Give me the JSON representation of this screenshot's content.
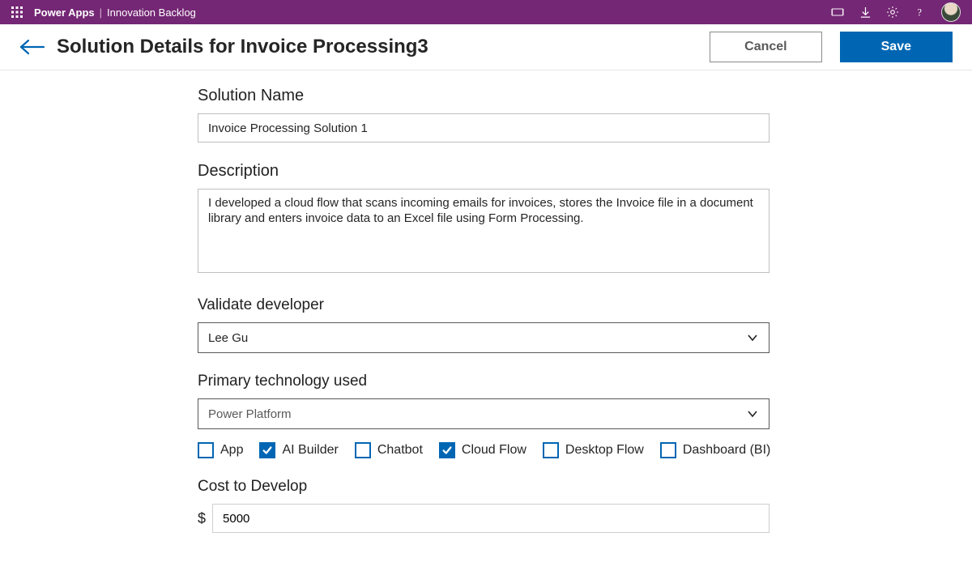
{
  "topbar": {
    "brand": "Power Apps",
    "app_name": "Innovation Backlog"
  },
  "header": {
    "title": "Solution Details for Invoice Processing3",
    "cancel_label": "Cancel",
    "save_label": "Save"
  },
  "form": {
    "solution_name": {
      "label": "Solution Name",
      "value": "Invoice Processing Solution 1"
    },
    "description": {
      "label": "Description",
      "value": "I developed a cloud flow that scans incoming emails for invoices, stores the Invoice file in a document library and enters invoice data to an Excel file using Form Processing."
    },
    "developer": {
      "label": "Validate developer",
      "value": "Lee Gu"
    },
    "primary_tech": {
      "label": "Primary technology used",
      "value": "Power Platform",
      "options": [
        {
          "label": "App",
          "checked": false
        },
        {
          "label": "AI Builder",
          "checked": true
        },
        {
          "label": "Chatbot",
          "checked": false
        },
        {
          "label": "Cloud Flow",
          "checked": true
        },
        {
          "label": "Desktop Flow",
          "checked": false
        },
        {
          "label": "Dashboard (BI)",
          "checked": false
        }
      ]
    },
    "cost": {
      "label": "Cost to Develop",
      "currency": "$",
      "value": "5000"
    }
  }
}
